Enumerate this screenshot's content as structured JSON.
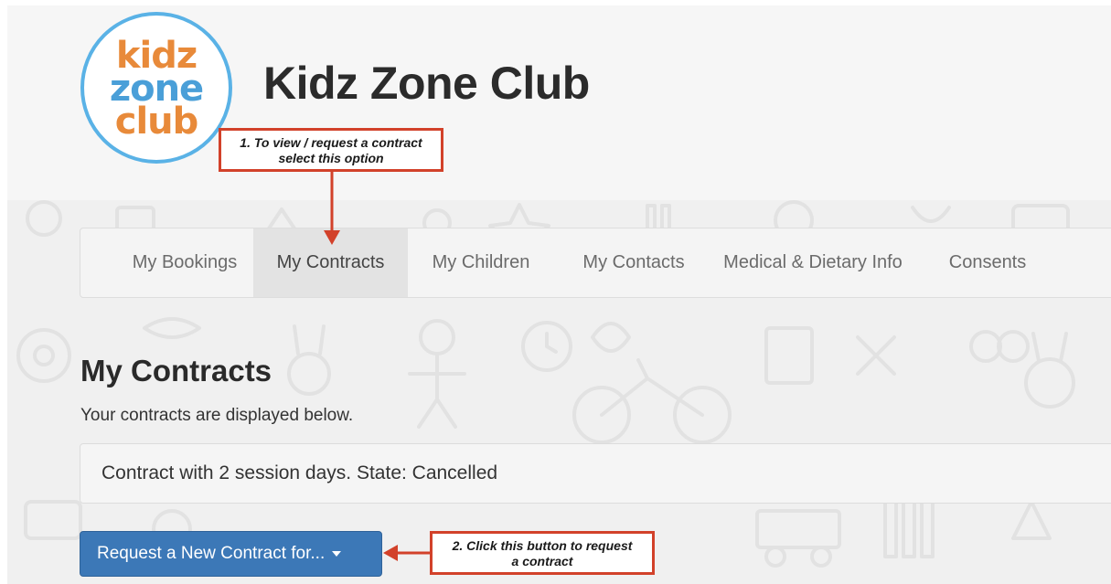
{
  "site": {
    "title": "Kidz Zone Club"
  },
  "logo": {
    "word1": "kidz",
    "word2": "zone",
    "word3": "club"
  },
  "nav": {
    "items": [
      {
        "label": "My Bookings"
      },
      {
        "label": "My Contracts"
      },
      {
        "label": "My Children"
      },
      {
        "label": "My Contacts"
      },
      {
        "label": "Medical & Dietary Info"
      },
      {
        "label": "Consents"
      }
    ],
    "active_index": 1
  },
  "content": {
    "title": "My Contracts",
    "subtitle": "Your contracts are displayed below.",
    "contract_text": "Contract with 2 session days. State: Cancelled",
    "request_button_label": "Request a New Contract for..."
  },
  "annotations": {
    "callout1_line1": "1. To view / request a contract",
    "callout1_line2": "select this option",
    "callout2_line1": "2. Click this button to request",
    "callout2_line2": "a contract"
  },
  "colors": {
    "accent": "#3c78b7",
    "callout_border": "#d2412a",
    "logo_ring": "#5ab2e6",
    "logo_orange": "#e88a3a"
  }
}
